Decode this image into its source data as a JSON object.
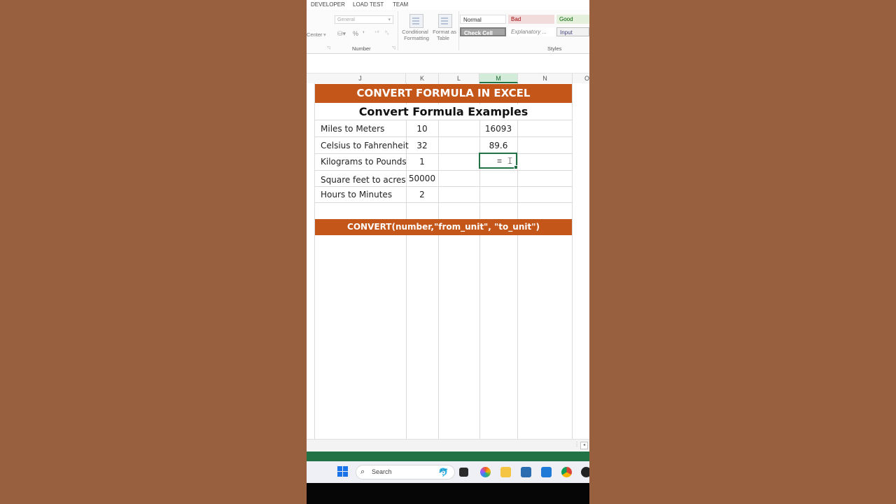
{
  "ribbon": {
    "tabs": [
      "DEVELOPER",
      "LOAD TEST",
      "TEAM"
    ],
    "number_format": "General",
    "center_label": "Center",
    "percent_symbol": "%",
    "number_group_label": "Number",
    "conditional_formatting": [
      "Conditional",
      "Formatting"
    ],
    "format_as_table": [
      "Format as",
      "Table"
    ],
    "styles_group_label": "Styles",
    "styles": [
      {
        "label": "Normal",
        "bg": "#ffffff",
        "fg": "#333333"
      },
      {
        "label": "Bad",
        "bg": "#f2dcdb",
        "fg": "#9c0006"
      },
      {
        "label": "Good",
        "bg": "#e4efdc",
        "fg": "#006100"
      },
      {
        "label": "Check Cell",
        "bg": "#a5a5a5",
        "fg": "#ffffff"
      },
      {
        "label": "Explanatory ...",
        "bg": "#ffffff",
        "fg": "#7f7f7f"
      },
      {
        "label": "Input",
        "bg": "#f2f2f2",
        "fg": "#3f3f76"
      }
    ]
  },
  "columns": [
    "J",
    "K",
    "L",
    "M",
    "N",
    "O"
  ],
  "sheet": {
    "title": "CONVERT FORMULA IN EXCEL",
    "subtitle": "Convert Formula Examples",
    "rows": [
      {
        "label": "Miles to Meters",
        "value": "10",
        "result": "16093"
      },
      {
        "label": "Celsius to Fahrenheit",
        "value": "32",
        "result": "89.6"
      },
      {
        "label": "Kilograms to Pounds",
        "value": "1",
        "result": ""
      },
      {
        "label": "Square feet to acres",
        "value": "50000",
        "result": ""
      },
      {
        "label": "Hours to Minutes",
        "value": "2",
        "result": ""
      }
    ],
    "formula_banner": "CONVERT(number,\"from_unit\", \"to_unit\")",
    "active_cell_text": "="
  },
  "taskbar": {
    "search_placeholder": "Search"
  },
  "colors": {
    "accent_orange": "#c5561a",
    "excel_green": "#217346"
  }
}
